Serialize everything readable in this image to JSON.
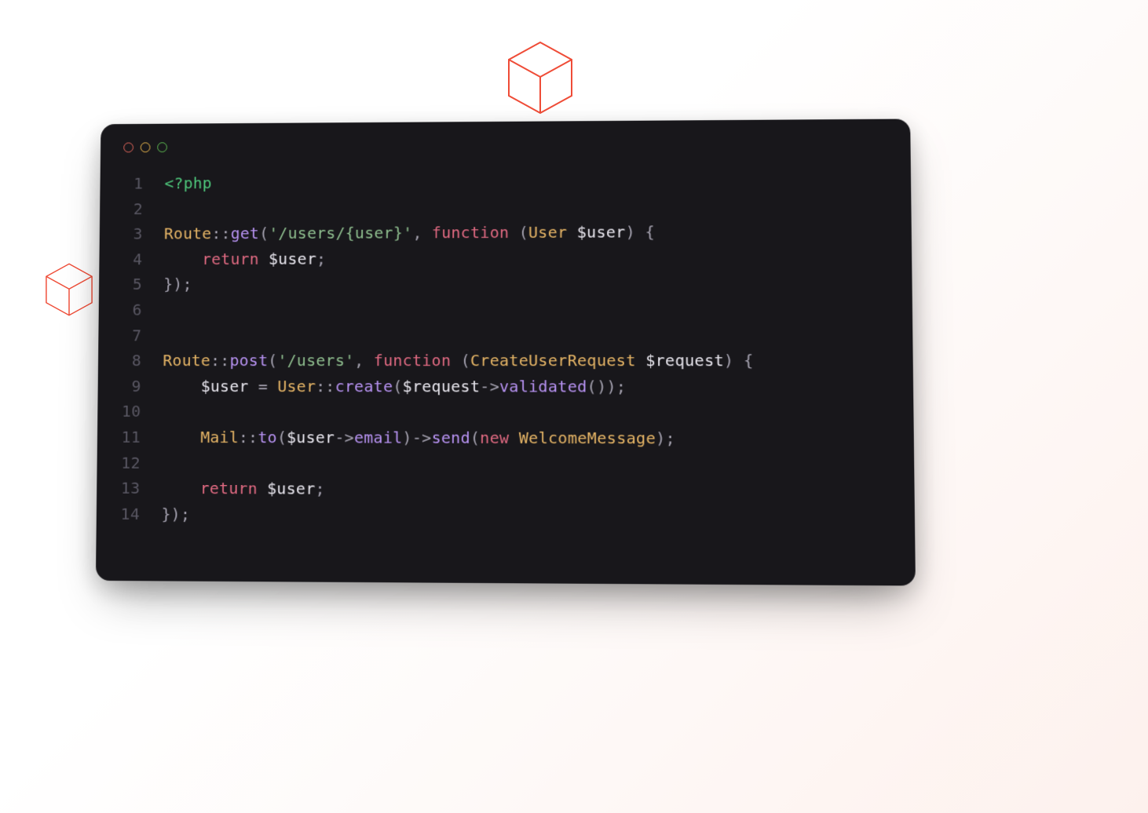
{
  "decorations": {
    "cube_top": "cube",
    "cube_left": "cube"
  },
  "editor": {
    "bg": "#18171b",
    "traffic": {
      "red": "#ed6a5e",
      "yellow": "#f4be4f",
      "green": "#61c454"
    },
    "colors": {
      "phptag": "#4ec77b",
      "class": "#e6b566",
      "method": "#b893f3",
      "string": "#8fbf8f",
      "keyword": "#e16a82",
      "punct": "#a6a3b1",
      "text": "#e9e7ef",
      "gutter": "#5a5864"
    },
    "lines": [
      {
        "n": "1",
        "tokens": [
          [
            "phptag",
            "<?php"
          ]
        ]
      },
      {
        "n": "2",
        "tokens": []
      },
      {
        "n": "3",
        "tokens": [
          [
            "class",
            "Route"
          ],
          [
            "scope",
            "::"
          ],
          [
            "method",
            "get"
          ],
          [
            "punct",
            "("
          ],
          [
            "string",
            "'/users/{user}'"
          ],
          [
            "punct",
            ", "
          ],
          [
            "keyword",
            "function "
          ],
          [
            "punct",
            "("
          ],
          [
            "class",
            "User"
          ],
          [
            "punct",
            " "
          ],
          [
            "var",
            "$user"
          ],
          [
            "punct",
            ") {"
          ]
        ]
      },
      {
        "n": "4",
        "tokens": [
          [
            "punct",
            "    "
          ],
          [
            "keyword",
            "return "
          ],
          [
            "var",
            "$user"
          ],
          [
            "punct",
            ";"
          ]
        ]
      },
      {
        "n": "5",
        "tokens": [
          [
            "punct",
            "});"
          ]
        ]
      },
      {
        "n": "6",
        "tokens": []
      },
      {
        "n": "7",
        "tokens": []
      },
      {
        "n": "8",
        "tokens": [
          [
            "class",
            "Route"
          ],
          [
            "scope",
            "::"
          ],
          [
            "method",
            "post"
          ],
          [
            "punct",
            "("
          ],
          [
            "string",
            "'/users'"
          ],
          [
            "punct",
            ", "
          ],
          [
            "keyword",
            "function "
          ],
          [
            "punct",
            "("
          ],
          [
            "class",
            "CreateUserRequest"
          ],
          [
            "punct",
            " "
          ],
          [
            "var",
            "$request"
          ],
          [
            "punct",
            ") {"
          ]
        ]
      },
      {
        "n": "9",
        "tokens": [
          [
            "punct",
            "    "
          ],
          [
            "var",
            "$user"
          ],
          [
            "punct",
            " = "
          ],
          [
            "class",
            "User"
          ],
          [
            "scope",
            "::"
          ],
          [
            "method",
            "create"
          ],
          [
            "punct",
            "("
          ],
          [
            "var",
            "$request"
          ],
          [
            "arrow",
            "->"
          ],
          [
            "prop",
            "validated"
          ],
          [
            "punct",
            "());"
          ]
        ]
      },
      {
        "n": "10",
        "tokens": []
      },
      {
        "n": "11",
        "tokens": [
          [
            "punct",
            "    "
          ],
          [
            "class",
            "Mail"
          ],
          [
            "scope",
            "::"
          ],
          [
            "method",
            "to"
          ],
          [
            "punct",
            "("
          ],
          [
            "var",
            "$user"
          ],
          [
            "arrow",
            "->"
          ],
          [
            "prop",
            "email"
          ],
          [
            "punct",
            ")"
          ],
          [
            "arrow",
            "->"
          ],
          [
            "prop",
            "send"
          ],
          [
            "punct",
            "("
          ],
          [
            "keyword",
            "new "
          ],
          [
            "class",
            "WelcomeMessage"
          ],
          [
            "punct",
            ");"
          ]
        ]
      },
      {
        "n": "12",
        "tokens": []
      },
      {
        "n": "13",
        "tokens": [
          [
            "punct",
            "    "
          ],
          [
            "keyword",
            "return "
          ],
          [
            "var",
            "$user"
          ],
          [
            "punct",
            ";"
          ]
        ]
      },
      {
        "n": "14",
        "tokens": [
          [
            "punct",
            "});"
          ]
        ]
      }
    ]
  }
}
